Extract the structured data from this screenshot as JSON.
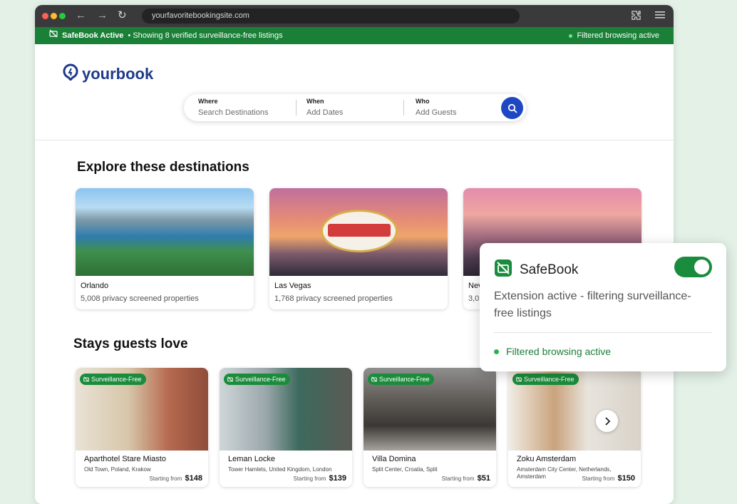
{
  "browser": {
    "url": "yourfavoritebookingsite.com"
  },
  "banner": {
    "brand": "SafeBook Active",
    "message": "• Showing 8 verified surveillance-free listings",
    "status": "Filtered browsing active"
  },
  "logo": {
    "text": "yourbook"
  },
  "search": {
    "where_label": "Where",
    "where_placeholder": "Search Destinations",
    "when_label": "When",
    "when_placeholder": "Add Dates",
    "who_label": "Who",
    "who_placeholder": "Add Guests"
  },
  "destinations": {
    "title": "Explore these destinations",
    "items": [
      {
        "name": "Orlando",
        "count": "5,008 privacy screened properties"
      },
      {
        "name": "Las Vegas",
        "count": "1,768 privacy screened properties"
      },
      {
        "name": "Nev",
        "count": "3,0"
      }
    ]
  },
  "stays": {
    "title": "Stays guests love",
    "badge": "Surveillance-Free",
    "price_prefix": "Starting from",
    "items": [
      {
        "name": "Aparthotel Stare Miasto",
        "location": "Old Town, Poland, Krakow",
        "price": "$148"
      },
      {
        "name": "Leman Locke",
        "location": "Tower Hamlets, United Kingdom, London",
        "price": "$139"
      },
      {
        "name": "Villa Domina",
        "location": "Split Center, Croatia, Split",
        "price": "$51"
      },
      {
        "name": "Zoku Amsterdam",
        "location": "Amsterdam City Center, Netherlands, Amsterdam",
        "price": "$150"
      }
    ]
  },
  "popup": {
    "title": "SafeBook",
    "description": "Extension active - filtering surveillance-free listings",
    "status": "Filtered browsing active",
    "toggle_on": true
  },
  "colors": {
    "brand_green": "#1a7f37",
    "logo_blue": "#1e3a8a",
    "search_button": "#1f47c4"
  },
  "icons": {
    "banner": "camera-off-icon",
    "search": "search-icon",
    "next": "chevron-right-icon",
    "extensions": "puzzle-icon",
    "menu": "hamburger-menu-icon"
  }
}
